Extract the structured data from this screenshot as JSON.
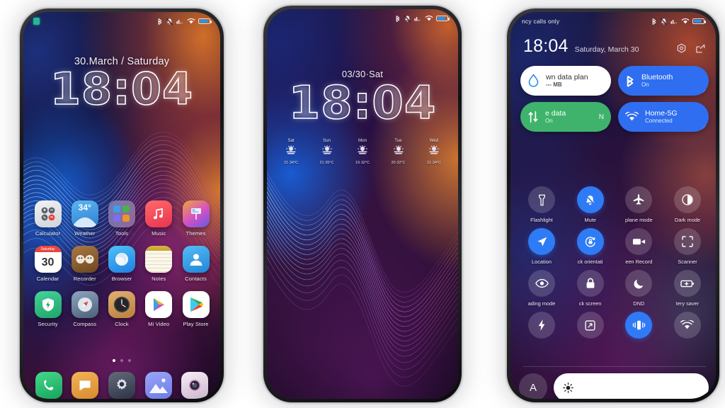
{
  "meta": {
    "scene": "three-phone-mockup-miui-theme"
  },
  "phone1": {
    "status": {
      "notification_icon": "notification-badge-icon",
      "icons": [
        "bluetooth-icon",
        "vibrate-mute-icon",
        "signal-bars-icon",
        "wifi-icon",
        "battery-icon"
      ]
    },
    "lock": {
      "date": "30.March / Saturday",
      "time": "18:04"
    },
    "apps_row1": [
      {
        "label": "Calculator",
        "icon": "calculator-icon"
      },
      {
        "label": "Weather",
        "icon": "weather-icon",
        "badge": "34°"
      },
      {
        "label": "Tools",
        "icon": "tools-folder-icon"
      },
      {
        "label": "Music",
        "icon": "music-icon"
      },
      {
        "label": "Themes",
        "icon": "themes-icon"
      }
    ],
    "apps_row2": [
      {
        "label": "Calendar",
        "icon": "calendar-icon",
        "day_name": "Saturday",
        "day_num": "30"
      },
      {
        "label": "Recorder",
        "icon": "recorder-icon"
      },
      {
        "label": "Browser",
        "icon": "browser-icon"
      },
      {
        "label": "Notes",
        "icon": "notes-icon"
      },
      {
        "label": "Contacts",
        "icon": "contacts-icon"
      }
    ],
    "apps_row3": [
      {
        "label": "Security",
        "icon": "security-shield-icon"
      },
      {
        "label": "Compass",
        "icon": "compass-icon"
      },
      {
        "label": "Clock",
        "icon": "clock-icon"
      },
      {
        "label": "Mi Video",
        "icon": "mi-video-icon"
      },
      {
        "label": "Play Store",
        "icon": "play-store-icon"
      }
    ],
    "page_dots": {
      "count": 3,
      "active": 1
    },
    "dock": [
      {
        "label": "Phone",
        "icon": "phone-icon"
      },
      {
        "label": "Messages",
        "icon": "messages-icon"
      },
      {
        "label": "Settings",
        "icon": "settings-gear-icon"
      },
      {
        "label": "Gallery",
        "icon": "gallery-icon"
      },
      {
        "label": "Camera",
        "icon": "camera-icon"
      }
    ]
  },
  "phone2": {
    "status": {
      "icons": [
        "bluetooth-icon",
        "vibrate-mute-icon",
        "signal-bars-icon",
        "wifi-icon",
        "battery-icon"
      ]
    },
    "lock": {
      "date": "03/30·Sat",
      "time": "18:04"
    },
    "forecast": [
      {
        "day": "Sat",
        "icon": "sun-cloud-icon",
        "temp": "21·34°C"
      },
      {
        "day": "Sun",
        "icon": "sun-cloud-icon",
        "temp": "21·35°C"
      },
      {
        "day": "Mon",
        "icon": "sun-cloud-icon",
        "temp": "19·32°C"
      },
      {
        "day": "Tue",
        "icon": "sun-cloud-icon",
        "temp": "20·32°C"
      },
      {
        "day": "Wed",
        "icon": "sun-cloud-icon",
        "temp": "21·34°C"
      }
    ]
  },
  "phone3": {
    "status": {
      "carrier": "ncy calls only",
      "icons": [
        "bluetooth-icon",
        "vibrate-mute-icon",
        "signal-bars-icon",
        "wifi-icon",
        "battery-icon"
      ]
    },
    "header": {
      "time": "18:04",
      "date": "Saturday, March 30",
      "settings_icon": "settings-hex-icon",
      "edit_icon": "edit-pencil-icon"
    },
    "big_tiles": [
      {
        "title": "wn data plan",
        "sub": "--- MB",
        "icon": "data-drop-icon",
        "state": "off",
        "bg": "#ffffff",
        "fg": "#333333"
      },
      {
        "title": "Bluetooth",
        "sub": "On",
        "icon": "bluetooth-icon",
        "state": "on",
        "bg": "#2f6ef0",
        "fg": "#ffffff"
      },
      {
        "title": "e data",
        "sub": "On",
        "icon": "mobile-data-icon",
        "state": "on",
        "bg": "#3fb36b",
        "fg": "#ffffff",
        "trailing": "N"
      },
      {
        "title": "Home-5G",
        "sub": "Connected",
        "icon": "wifi-icon",
        "state": "on",
        "bg": "#2f6ef0",
        "fg": "#ffffff"
      }
    ],
    "toggles": [
      {
        "label": "Flashlight",
        "icon": "flashlight-icon",
        "on": false
      },
      {
        "label": "Mute",
        "icon": "bell-slash-icon",
        "on": true
      },
      {
        "label": "plane mode",
        "icon": "airplane-icon",
        "on": false
      },
      {
        "label": "Dark mode",
        "icon": "contrast-circle-icon",
        "on": false
      },
      {
        "label": "Location",
        "icon": "location-arrow-icon",
        "on": true
      },
      {
        "label": "ck orientati",
        "icon": "rotation-lock-icon",
        "on": true
      },
      {
        "label": "een Record",
        "icon": "video-camera-icon",
        "on": false
      },
      {
        "label": "Scanner",
        "icon": "scan-frame-icon",
        "on": false
      },
      {
        "label": "ading mode",
        "icon": "eye-icon",
        "on": false
      },
      {
        "label": "ck screen",
        "icon": "padlock-icon",
        "on": false
      },
      {
        "label": "DND",
        "icon": "moon-icon",
        "on": false
      },
      {
        "label": "tery saver",
        "icon": "battery-plus-icon",
        "on": false
      },
      {
        "label": "",
        "icon": "lightning-bolt-icon",
        "on": false
      },
      {
        "label": "",
        "icon": "cast-screen-icon",
        "on": false
      },
      {
        "label": "",
        "icon": "vibrate-icon",
        "on": true
      },
      {
        "label": "",
        "icon": "hotspot-icon",
        "on": false
      }
    ],
    "brightness": {
      "auto_label": "A",
      "icon": "brightness-sun-icon",
      "level": 96
    }
  },
  "colors": {
    "accent_blue": "#2f6ef0",
    "accent_green": "#3fb36b",
    "tile_white": "#ffffff",
    "status_battery": "#2196f3"
  }
}
